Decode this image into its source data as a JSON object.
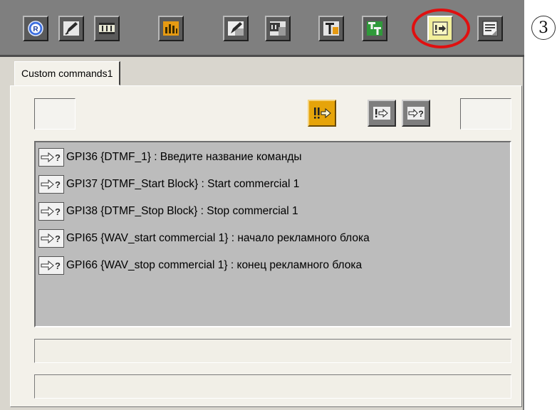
{
  "tab": {
    "label": "Custom commands1"
  },
  "callout": {
    "number": "3"
  },
  "toolbar": {
    "buttons": [
      {
        "icon": "registered-icon"
      },
      {
        "icon": "edit-icon"
      },
      {
        "icon": "film-icon"
      },
      {
        "icon": "audio-levels-icon"
      },
      {
        "icon": "edit-transparent-icon"
      },
      {
        "icon": "film-transparent-icon"
      },
      {
        "icon": "title-icon"
      },
      {
        "icon": "double-title-icon"
      },
      {
        "icon": "custom-commands-icon",
        "active": true
      },
      {
        "icon": "document-icon"
      }
    ]
  },
  "commands": {
    "buttons": [
      {
        "icon": "run-command-icon",
        "style": "gold"
      },
      {
        "icon": "execute-icon"
      },
      {
        "icon": "query-command-icon"
      }
    ],
    "items": [
      {
        "icon": "query-command-icon",
        "text": "GPI36 {DTMF_1} : Введите название команды"
      },
      {
        "icon": "query-command-icon",
        "text": "GPI37 {DTMF_Start Block} : Start commercial 1"
      },
      {
        "icon": "query-command-icon",
        "text": "GPI38 {DTMF_Stop Block} : Stop commercial 1"
      },
      {
        "icon": "query-command-icon",
        "text": "GPI65 {WAV_start commercial 1} : начало рекламного блока"
      },
      {
        "icon": "query-command-icon",
        "text": "GPI66 {WAV_stop commercial 1} : конец рекламного блока"
      }
    ]
  },
  "colors": {
    "toolbar_bg": "#7f7f7f",
    "panel_bg": "#f3f1ea",
    "list_bg": "#bcbcbc",
    "highlight": "#e01010",
    "active_button": "#f2ef9a",
    "gold_button": "#e6a40a"
  }
}
